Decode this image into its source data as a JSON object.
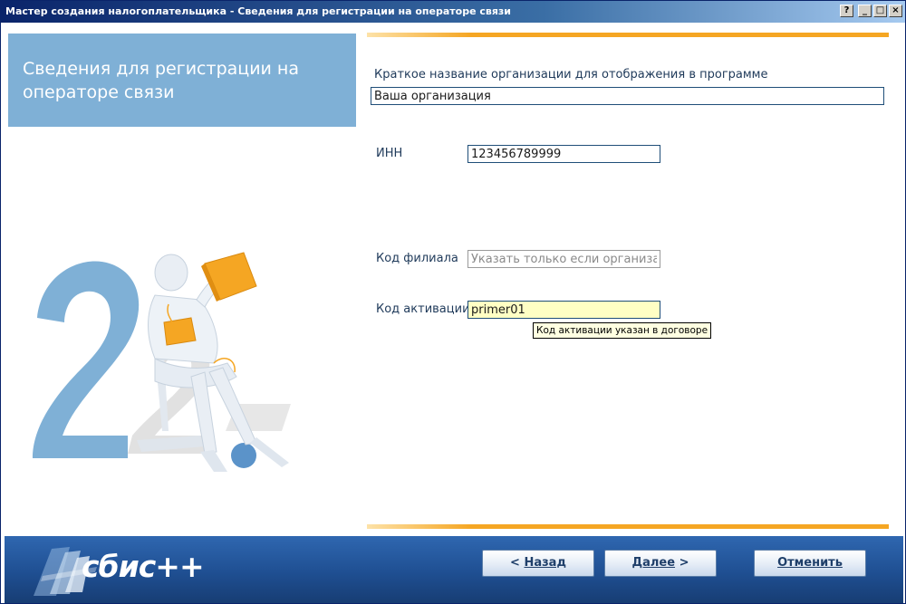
{
  "window": {
    "title": "Мастер создания налогоплательщика - Сведения для регистрации на операторе связи",
    "help_glyph": "?",
    "minimize_glyph": "_",
    "maximize_glyph": "□",
    "close_glyph": "×"
  },
  "left_panel": {
    "heading": "Сведения для регистрации на операторе связи"
  },
  "form": {
    "org_name": {
      "label": "Краткое название организации для отображения в программе",
      "value": "Ваша организация"
    },
    "inn": {
      "label": "ИНН",
      "value": "123456789999"
    },
    "branch_code": {
      "label": "Код филиала",
      "placeholder": "Указать только если организа"
    },
    "activation_code": {
      "label": "Код активации",
      "value": "primer01",
      "tooltip": "Код активации указан в договоре"
    }
  },
  "footer": {
    "logo_text": "сбис++",
    "back": {
      "arrow": "<",
      "label": "Назад"
    },
    "next": {
      "arrow": ">",
      "label": "Далее"
    },
    "cancel": {
      "label": "Отменить"
    }
  },
  "colors": {
    "title_bar": "#0a246a",
    "accent_orange": "#f5a623",
    "banner_blue": "#7fb0d6",
    "footer_blue": "#1f4f92",
    "active_field": "#ffffc4"
  }
}
